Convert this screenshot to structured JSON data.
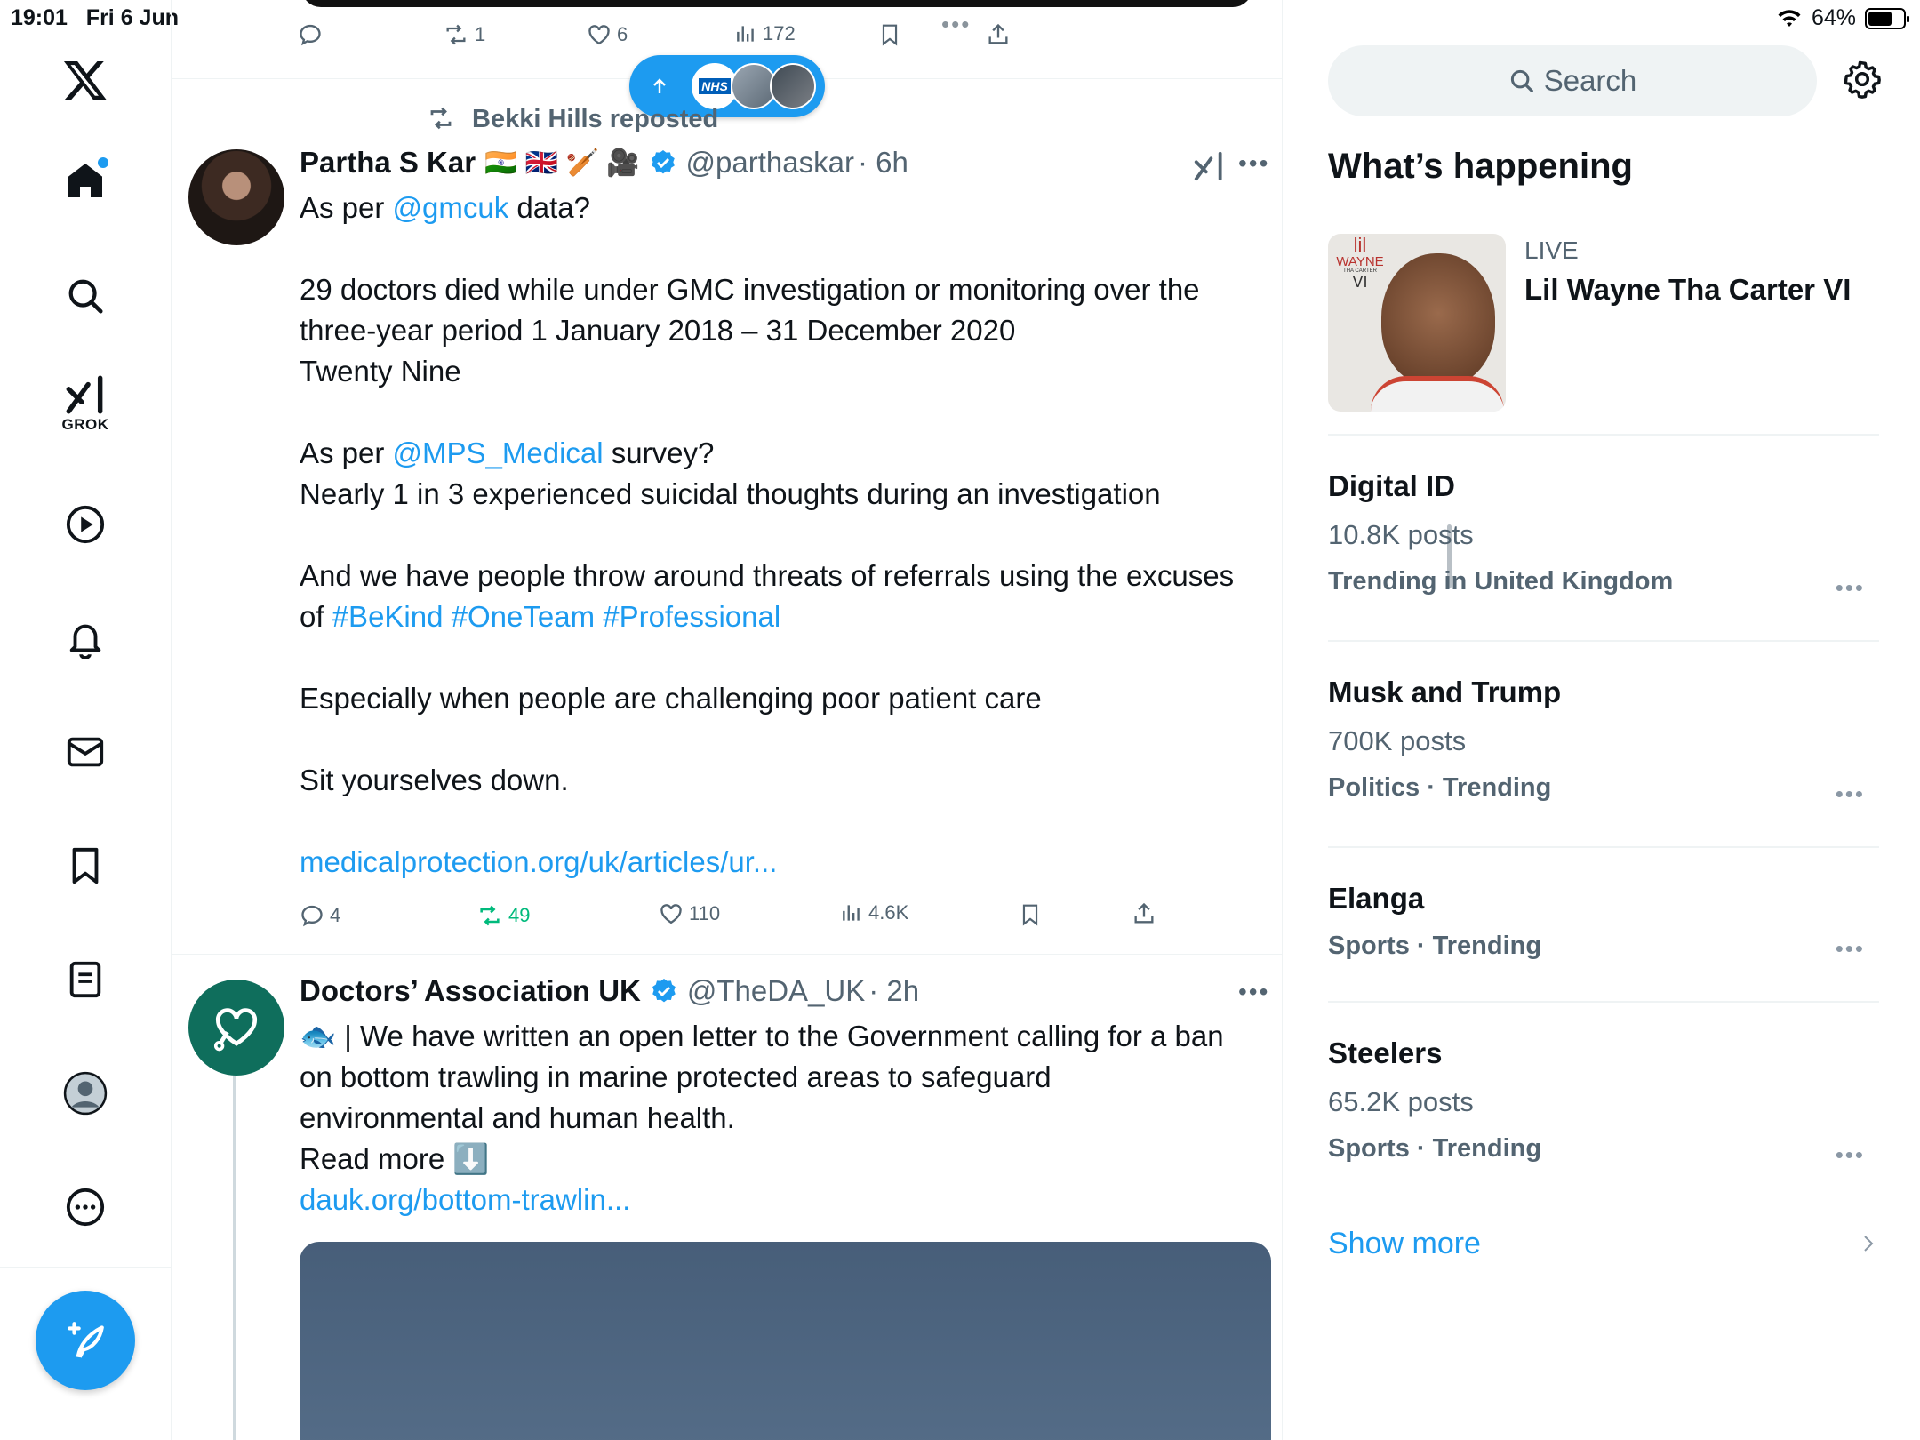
{
  "status_bar": {
    "time": "19:01",
    "date": "Fri 6 Jun",
    "battery": "64%",
    "battery_level": 0.64
  },
  "nav": {
    "items": [
      "x-logo",
      "home-icon",
      "search-icon",
      "grok-icon",
      "video-icon",
      "notifications-icon",
      "messages-icon",
      "bookmarks-icon",
      "lists-icon",
      "profile-icon",
      "more-icon"
    ],
    "grok_label": "GROK"
  },
  "prev_tweet": {
    "reposts": "1",
    "likes": "6",
    "views": "172"
  },
  "new_posts_pill": {
    "badge": "NHS"
  },
  "tweet1": {
    "reposted_by": "Bekki Hills reposted",
    "name": "Partha S Kar",
    "flags": "🇮🇳 🇬🇧 🏏 🎥",
    "handle": "@parthaskar",
    "time": "· 6h",
    "lines": {
      "l1_pre": "As per ",
      "l1_link": "@gmcuk",
      "l1_post": " data?",
      "l2": "29 doctors died while under GMC investigation or monitoring over the",
      "l3": "three-year period 1 January 2018 – 31 December 2020",
      "l4": "Twenty Nine",
      "l5_pre": "As per ",
      "l5_link": "@MPS_Medical",
      "l5_post": " survey?",
      "l6": "Nearly 1 in 3 experienced suicidal thoughts during an investigation",
      "l7": "And we have people throw around threats of referrals using the excuses",
      "l8_pre": "of ",
      "l8_tags": "#BeKind #OneTeam #Professional",
      "l9": "Especially when people are challenging poor patient care",
      "l10": "Sit yourselves down.",
      "link": "medicalprotection.org/uk/articles/ur..."
    },
    "stats": {
      "replies": "4",
      "reposts": "49",
      "likes": "110",
      "views": "4.6K"
    }
  },
  "tweet2": {
    "name": "Doctors’ Association UK",
    "handle": "@TheDA_UK",
    "time": "· 2h",
    "lines": {
      "l1": "🐟 | We have written an open letter to the Government calling for a ban",
      "l2": "on bottom trawling in marine protected areas to safeguard",
      "l3": "environmental and human health.",
      "l4": "Read more ⬇️",
      "link": "dauk.org/bottom-trawlin..."
    }
  },
  "sidebar": {
    "search_placeholder": "Search",
    "title": "What’s happening",
    "live": {
      "label": "LIVE",
      "title": "Lil Wayne Tha Carter VI",
      "cover_text_1": "lil",
      "cover_text_2": "WAYNE",
      "cover_text_3": "THA CARTER",
      "cover_text_4": "VI"
    },
    "trends": [
      {
        "name": "Digital ID",
        "posts": "10.8K posts",
        "category": "Trending in United Kingdom"
      },
      {
        "name": "Musk and Trump",
        "posts": "700K posts",
        "category": "Politics · Trending"
      },
      {
        "name": "Elanga",
        "posts": "",
        "category": "Sports · Trending"
      },
      {
        "name": "Steelers",
        "posts": "65.2K posts",
        "category": "Sports · Trending"
      }
    ],
    "show_more": "Show more"
  }
}
